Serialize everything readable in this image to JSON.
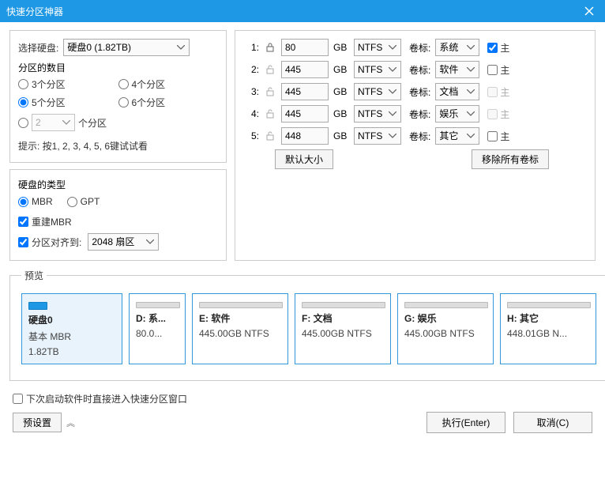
{
  "title": "快速分区神器",
  "left": {
    "disk_label": "选择硬盘:",
    "disk_value": "硬盘0 (1.82TB)",
    "count_legend": "分区的数目",
    "count_options": {
      "opt3": "3个分区",
      "opt4": "4个分区",
      "opt5": "5个分区",
      "opt6": "6个分区",
      "custom_suffix": "个分区",
      "custom_value": "2"
    },
    "hint": "提示: 按1, 2, 3, 4, 5, 6键试试看",
    "type_legend": "硬盘的类型",
    "type_mbr": "MBR",
    "type_gpt": "GPT",
    "rebuild_mbr": "重建MBR",
    "align_label": "分区对齐到:",
    "align_value": "2048 扇区"
  },
  "parts": [
    {
      "idx": "1:",
      "locked": true,
      "size": "80",
      "fs": "NTFS",
      "label_lbl": "卷标:",
      "label": "系统",
      "primary": "主",
      "primary_checked": true,
      "primary_disabled": false
    },
    {
      "idx": "2:",
      "locked": false,
      "size": "445",
      "fs": "NTFS",
      "label_lbl": "卷标:",
      "label": "软件",
      "primary": "主",
      "primary_checked": false,
      "primary_disabled": false
    },
    {
      "idx": "3:",
      "locked": false,
      "size": "445",
      "fs": "NTFS",
      "label_lbl": "卷标:",
      "label": "文档",
      "primary": "主",
      "primary_checked": false,
      "primary_disabled": true
    },
    {
      "idx": "4:",
      "locked": false,
      "size": "445",
      "fs": "NTFS",
      "label_lbl": "卷标:",
      "label": "娱乐",
      "primary": "主",
      "primary_checked": false,
      "primary_disabled": true
    },
    {
      "idx": "5:",
      "locked": false,
      "size": "448",
      "fs": "NTFS",
      "label_lbl": "卷标:",
      "label": "其它",
      "primary": "主",
      "primary_checked": false,
      "primary_disabled": false
    }
  ],
  "right_buttons": {
    "gb": "GB",
    "default_size": "默认大小",
    "remove_labels": "移除所有卷标"
  },
  "preview": {
    "legend": "预览",
    "disk": {
      "name": "硬盘0",
      "type": "基本 MBR",
      "size": "1.82TB"
    },
    "parts": [
      {
        "name": "D: 系...",
        "info": "80.0..."
      },
      {
        "name": "E: 软件",
        "info": "445.00GB NTFS"
      },
      {
        "name": "F: 文档",
        "info": "445.00GB NTFS"
      },
      {
        "name": "G: 娱乐",
        "info": "445.00GB NTFS"
      },
      {
        "name": "H: 其它",
        "info": "448.01GB N..."
      }
    ]
  },
  "bottom": {
    "next_launch": "下次启动软件时直接进入快速分区窗口",
    "preset": "预设置",
    "execute": "执行(Enter)",
    "cancel": "取消(C)"
  }
}
